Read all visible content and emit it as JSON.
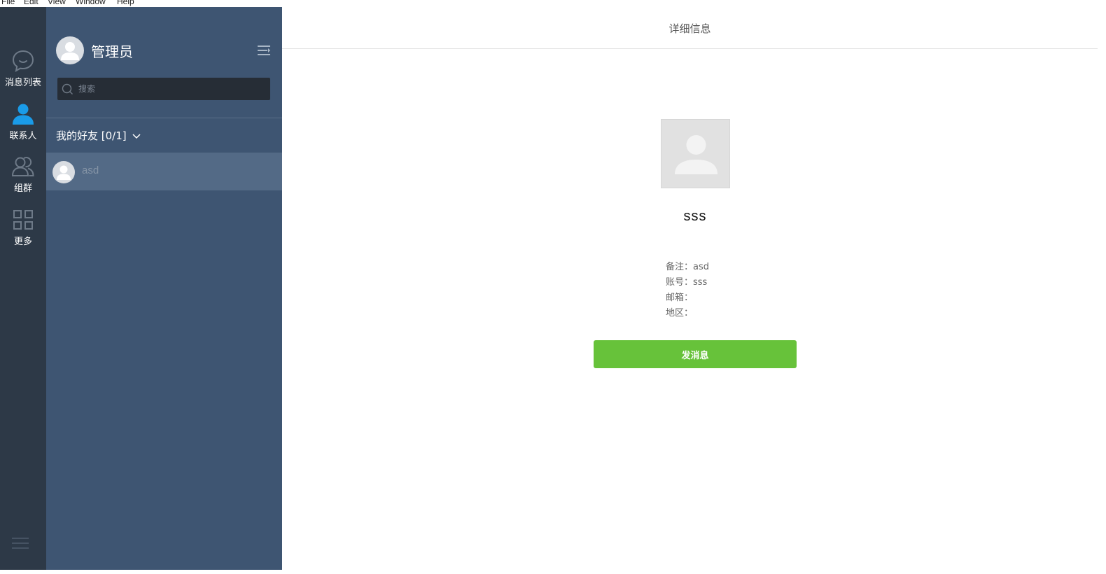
{
  "menubar": {
    "items": [
      "File",
      "Edit",
      "View",
      "Window",
      "Help"
    ]
  },
  "rail": {
    "items": [
      {
        "label": "消息列表",
        "icon": "chat-bubble-icon",
        "active": false
      },
      {
        "label": "联系人",
        "icon": "person-icon",
        "active": true
      },
      {
        "label": "组群",
        "icon": "group-icon",
        "active": false
      },
      {
        "label": "更多",
        "icon": "grid-icon",
        "active": false
      }
    ],
    "bottom_icon": "hamburger-menu-icon"
  },
  "panel": {
    "user_name": "管理员",
    "search_placeholder": "搜索",
    "group_label": "我的好友 [0/1]",
    "contacts": [
      {
        "name": "asd"
      }
    ]
  },
  "main": {
    "header_title": "详细信息",
    "contact_name": "sss",
    "info": {
      "remark": "备注：asd",
      "account": "账号：sss",
      "email": "邮箱：",
      "region": "地区："
    },
    "send_button": "发消息"
  },
  "colors": {
    "rail_bg": "#2d3947",
    "panel_bg": "#3e5572",
    "active_icon": "#1a9be8",
    "send_button": "#67c23a"
  }
}
